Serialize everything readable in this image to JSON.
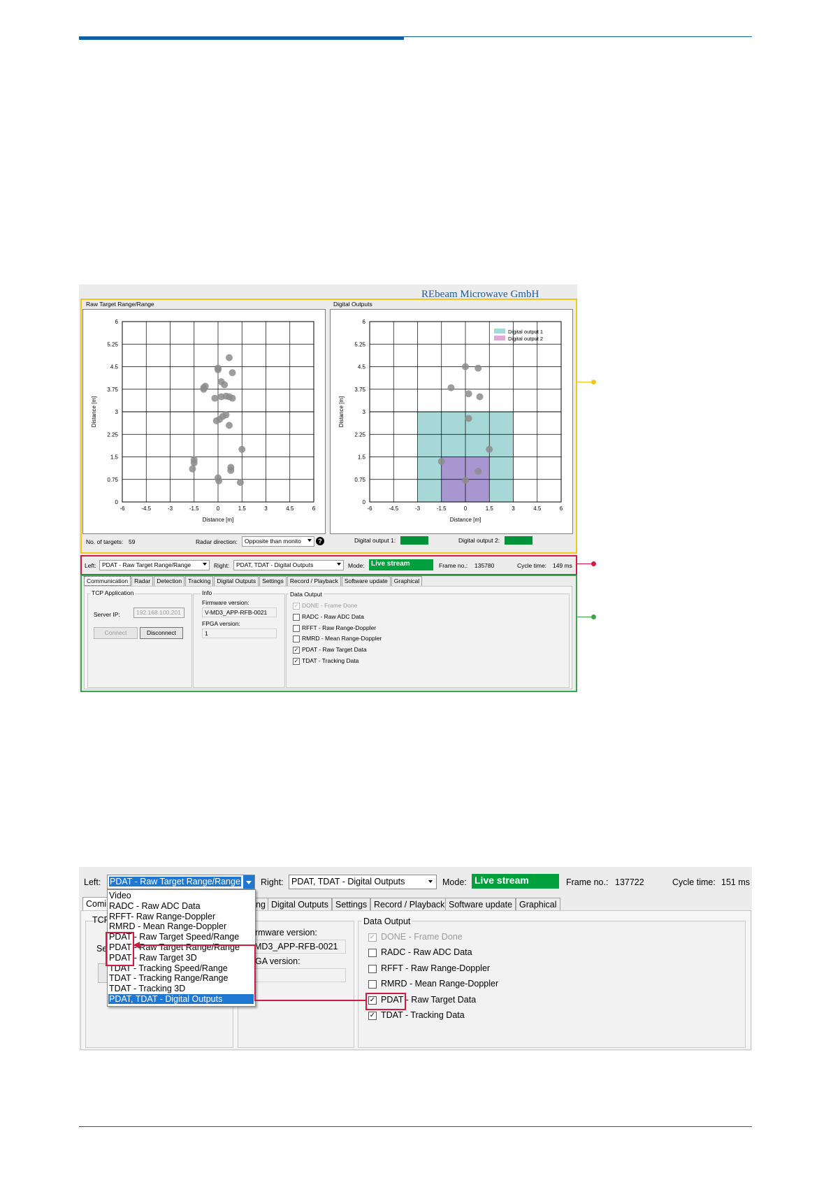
{
  "brand": "REbeam Microwave GmbH",
  "screenshot1": {
    "left_chart": {
      "title": "Raw Target Range/Range",
      "footer_label": "No. of targets:",
      "footer_value": "59",
      "radar_direction_label": "Radar direction:",
      "radar_direction_value": "Opposite than monito",
      "help_icon": "question-circle-icon"
    },
    "right_chart": {
      "title": "Digital Outputs",
      "out1_label": "Digital output 1:",
      "out2_label": "Digital output 2:",
      "out_color": "#00933a"
    },
    "toolbar": {
      "left_label": "Left:",
      "left_value": "PDAT - Raw Target Range/Range",
      "right_label": "Right:",
      "right_value": "PDAT, TDAT - Digital Outputs",
      "mode_label": "Mode:",
      "mode_value": "Live stream",
      "frame_label": "Frame no.:",
      "frame_value": "135780",
      "cycle_label": "Cycle time:",
      "cycle_value": "149 ms"
    },
    "tabs": [
      "Communication",
      "Radar",
      "Detection",
      "Tracking",
      "Digital Outputs",
      "Settings",
      "Record / Playback",
      "Software update",
      "Graphical"
    ],
    "tcp": {
      "title": "TCP Application",
      "server_ip_label": "Server IP:",
      "server_ip_value": "192.168.100.201",
      "connect": "Connect",
      "disconnect": "Disconnect"
    },
    "info": {
      "title": "Info",
      "firmware_label": "Firmware version:",
      "firmware_value": "V-MD3_APP-RFB-0021",
      "fpga_label": "FPGA version:",
      "fpga_value": "1"
    },
    "data_output": {
      "title": "Data Output",
      "items": [
        {
          "label": "DONE - Frame Done",
          "checked": true,
          "disabled": true
        },
        {
          "label": "RADC - Raw ADC Data",
          "checked": false,
          "disabled": false
        },
        {
          "label": "RFFT - Raw Range-Doppler",
          "checked": false,
          "disabled": false
        },
        {
          "label": "RMRD - Mean Range-Doppler",
          "checked": false,
          "disabled": false
        },
        {
          "label": "PDAT - Raw Target Data",
          "checked": true,
          "disabled": false
        },
        {
          "label": "TDAT - Tracking Data",
          "checked": true,
          "disabled": false
        }
      ]
    }
  },
  "chart_data": [
    {
      "type": "scatter",
      "title": "Raw Target Range/Range",
      "xlabel": "Distance [m]",
      "ylabel": "Distance [m]",
      "xlim": [
        -6,
        6
      ],
      "ylim": [
        0,
        6
      ],
      "xticks": [
        "-6",
        "-4.5",
        "-3",
        "-1.5",
        "0",
        "1.5",
        "3",
        "4.5",
        "6"
      ],
      "yticks": [
        "0",
        "0.75",
        "1.5",
        "2.25",
        "3",
        "3.75",
        "4.5",
        "5.25",
        "6"
      ],
      "grid": true,
      "points": [
        [
          0.7,
          4.8
        ],
        [
          0.9,
          4.3
        ],
        [
          0,
          4.45
        ],
        [
          0,
          4.4
        ],
        [
          0.2,
          4.0
        ],
        [
          0.4,
          3.9
        ],
        [
          -0.9,
          3.8
        ],
        [
          -0.8,
          3.85
        ],
        [
          -0.9,
          3.75
        ],
        [
          -0.2,
          3.45
        ],
        [
          0.2,
          3.5
        ],
        [
          0.5,
          3.52
        ],
        [
          0.7,
          3.5
        ],
        [
          0.9,
          3.45
        ],
        [
          0.5,
          2.9
        ],
        [
          0.3,
          2.85
        ],
        [
          0.1,
          2.75
        ],
        [
          -0.1,
          2.7
        ],
        [
          0.7,
          2.55
        ],
        [
          1.5,
          1.75
        ],
        [
          -1.5,
          1.4
        ],
        [
          -1.5,
          1.3
        ],
        [
          -1.6,
          1.1
        ],
        [
          0.8,
          1.15
        ],
        [
          0.8,
          1.05
        ],
        [
          0,
          0.8
        ],
        [
          0.05,
          0.7
        ],
        [
          1.4,
          0.65
        ]
      ]
    },
    {
      "type": "scatter",
      "title": "Digital Outputs",
      "xlabel": "Distance [m]",
      "ylabel": "Distance [m]",
      "xlim": [
        -6,
        6
      ],
      "ylim": [
        0,
        6
      ],
      "xticks": [
        "-6",
        "-4.5",
        "-3",
        "-1.5",
        "0",
        "1.5",
        "3",
        "4.5",
        "6"
      ],
      "yticks": [
        "0",
        "0.75",
        "1.5",
        "2.25",
        "3",
        "3.75",
        "4.5",
        "5.25",
        "6"
      ],
      "grid": true,
      "legend": {
        "position": "top-right",
        "items": [
          {
            "name": "Digital output 1",
            "color": "#a6d8d8"
          },
          {
            "name": "Digital output 2",
            "color": "#e0a9d6"
          }
        ]
      },
      "zones": [
        {
          "name": "Digital output 1",
          "x": [
            -3,
            3
          ],
          "y": [
            0,
            3
          ],
          "color": "#a6d8d8"
        },
        {
          "name": "Digital output 2",
          "x": [
            -1.5,
            1.5
          ],
          "y": [
            0,
            1.5
          ],
          "color": "#a796cf"
        }
      ],
      "points": [
        [
          0,
          4.5
        ],
        [
          0.8,
          4.45
        ],
        [
          -0.9,
          3.8
        ],
        [
          0.2,
          3.6
        ],
        [
          0.9,
          3.5
        ],
        [
          0.2,
          2.78
        ],
        [
          1.5,
          1.75
        ],
        [
          -1.5,
          1.35
        ],
        [
          0.8,
          1.02
        ],
        [
          0,
          0.72
        ]
      ]
    }
  ],
  "screenshot2": {
    "left_label": "Left:",
    "left_value": "PDAT - Raw Target Range/Range",
    "right_label": "Right:",
    "right_value": "PDAT, TDAT - Digital Outputs",
    "mode_label": "Mode:",
    "mode_value": "Live stream",
    "frame_label": "Frame no.:",
    "frame_value": "137722",
    "cycle_label": "Cycle time:",
    "cycle_value": "151 ms",
    "tabs_visible": [
      "Comi",
      "ng",
      "Digital Outputs",
      "Settings",
      "Record / Playback",
      "Software update",
      "Graphical"
    ],
    "tcp_fragment": "TCP",
    "se_fragment": "Se",
    "firmware_label": "rmware version:",
    "firmware_value": "MD3_APP-RFB-0021",
    "fpga_label": "GA version:",
    "data_output_title": "Data Output",
    "data_items": [
      {
        "label": "DONE - Frame Done",
        "checked": true,
        "disabled": true
      },
      {
        "label": "RADC - Raw ADC Data",
        "checked": false,
        "disabled": false
      },
      {
        "label": "RFFT - Raw Range-Doppler",
        "checked": false,
        "disabled": false
      },
      {
        "label": "RMRD - Mean Range-Doppler",
        "checked": false,
        "disabled": false
      },
      {
        "label": "PDAT - Raw Target Data",
        "checked": true,
        "disabled": false
      },
      {
        "label": "TDAT - Tracking Data",
        "checked": true,
        "disabled": false
      }
    ],
    "dropdown_options": [
      "Video",
      "RADC - Raw ADC Data",
      "RFFT- Raw Range-Doppler",
      "RMRD - Mean Range-Doppler",
      "PDAT - Raw Target Speed/Range",
      "PDAT - Raw Target Range/Range",
      "PDAT - Raw Target 3D",
      "TDAT - Tracking Speed/Range",
      "TDAT - Tracking Range/Range",
      "TDAT - Tracking 3D",
      "PDAT, TDAT - Digital Outputs"
    ],
    "dropdown_selected_index": 10
  },
  "colors": {
    "accent_blue": "#0e5fa6",
    "callout_yellow": "#f5c518",
    "callout_red": "#d31a43",
    "callout_green": "#3aa64a",
    "live_green": "#00a03c",
    "point_grey": "#8c8c8c"
  }
}
